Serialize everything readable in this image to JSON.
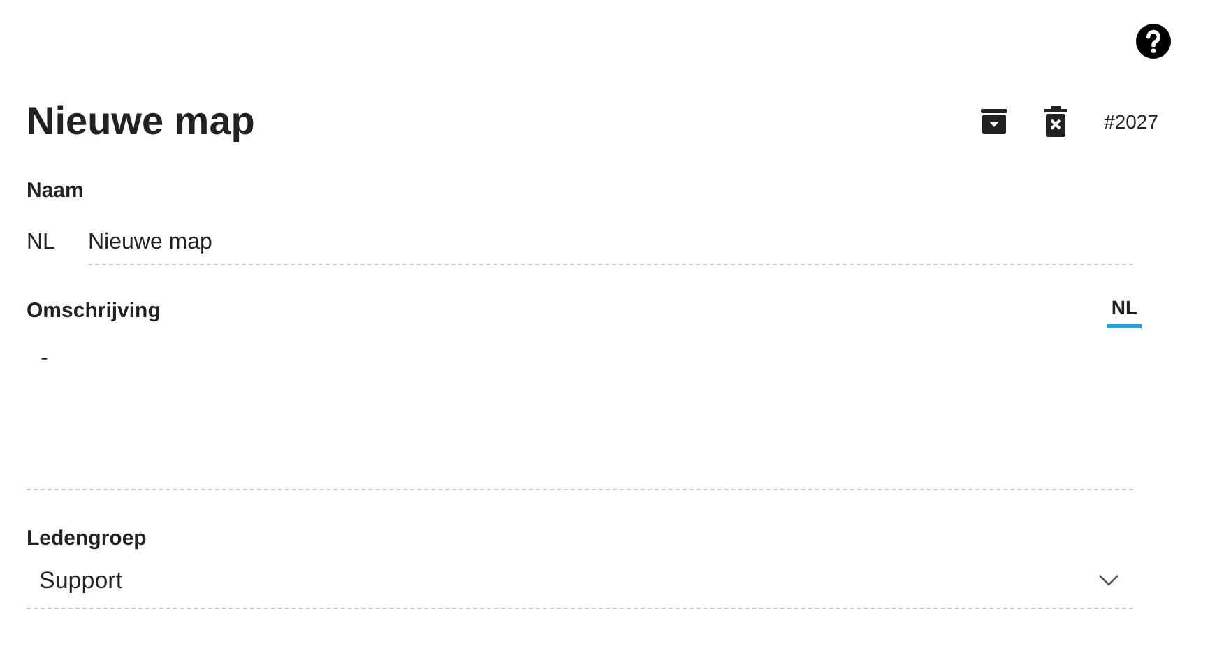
{
  "title": "Nieuwe map",
  "id_label": "#2027",
  "name_field": {
    "label": "Naam",
    "language": "NL",
    "value": "Nieuwe map"
  },
  "description_field": {
    "label": "Omschrijving",
    "language_tabs": [
      {
        "label": "NL",
        "selected": true
      }
    ],
    "value": "-"
  },
  "group_field": {
    "label": "Ledengroep",
    "value": "Support"
  }
}
